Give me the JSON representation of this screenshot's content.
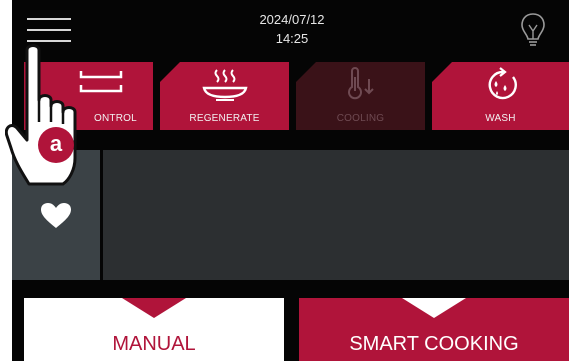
{
  "header": {
    "date": "2024/07/12",
    "time": "14:25"
  },
  "icons": {
    "menu": "hamburger-menu-icon",
    "info": "lightbulb-icon",
    "favorites": "heart-icon"
  },
  "tabs": [
    {
      "label": "ONTROL",
      "icon": "tray-icon",
      "state": "active"
    },
    {
      "label": "REGENERATE",
      "icon": "plate-steam-icon",
      "state": "active"
    },
    {
      "label": "COOLING",
      "icon": "thermometer-down-icon",
      "state": "disabled"
    },
    {
      "label": "WASH",
      "icon": "wash-cycle-icon",
      "state": "active"
    }
  ],
  "modes": {
    "manual": "MANUAL",
    "smart": "SMART COOKING"
  },
  "annotation": {
    "badge": "a"
  },
  "colors": {
    "accent": "#b0143a",
    "background": "#050505",
    "panel": "#2c2f31",
    "favorites_tab": "#3b4246"
  }
}
